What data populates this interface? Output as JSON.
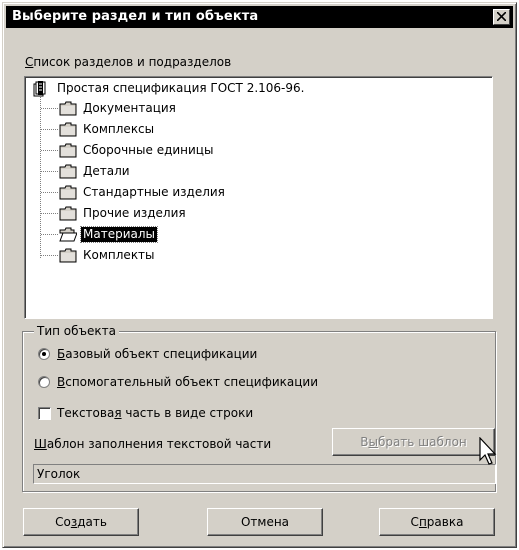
{
  "dialog": {
    "title": "Выберите раздел и тип объекта",
    "close_symbol": "×"
  },
  "tree_section": {
    "label_accel": "С",
    "label_rest": "писок разделов и подразделов",
    "root": {
      "label": "Простая спецификация ГОСТ 2.106-96.",
      "icon": "document-stack-icon"
    },
    "children": [
      {
        "label": "Документация",
        "icon": "folder-icon",
        "selected": false
      },
      {
        "label": "Комплексы",
        "icon": "folder-icon",
        "selected": false
      },
      {
        "label": "Сборочные единицы",
        "icon": "folder-icon",
        "selected": false
      },
      {
        "label": "Детали",
        "icon": "folder-icon",
        "selected": false
      },
      {
        "label": "Стандартные изделия",
        "icon": "folder-icon",
        "selected": false
      },
      {
        "label": "Прочие изделия",
        "icon": "folder-icon",
        "selected": false
      },
      {
        "label": "Материалы",
        "icon": "open-folder-icon",
        "selected": true
      },
      {
        "label": "Комплекты",
        "icon": "folder-icon",
        "selected": false
      }
    ]
  },
  "object_type": {
    "group_label": "Тип объекта",
    "options": [
      {
        "accel": "Б",
        "rest": "азовый объект спецификации",
        "checked": true
      },
      {
        "accel": "В",
        "rest": "спомогательный объект спецификации",
        "checked": false
      }
    ],
    "text_as_line": {
      "pre": "Текстова",
      "accel": "я",
      "post": " часть в виде строки",
      "checked": false
    },
    "template_label": {
      "accel": "Ш",
      "rest": "аблон заполнения текстовой части"
    },
    "choose_template_button": {
      "pre": "В",
      "accel": "ы",
      "post": "брать шаблон",
      "enabled": false
    },
    "template_value": "Уголок"
  },
  "buttons": {
    "create": {
      "pre": "Со",
      "accel": "з",
      "post": "дать"
    },
    "cancel": {
      "label": "Отмена"
    },
    "help": {
      "pre": "С",
      "accel": "п",
      "post": "равка"
    }
  },
  "colors": {
    "dialog_face": "#d4d0c8",
    "titlebar": "#000000",
    "selection": "#000000",
    "disabled_text": "#808080"
  }
}
